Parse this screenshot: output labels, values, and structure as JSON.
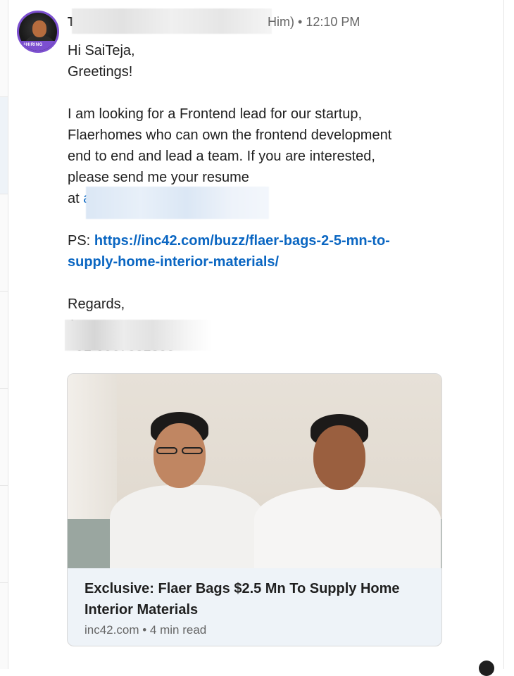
{
  "message": {
    "sender_initial": "T",
    "sender_tail": "Him)",
    "time": "12:10 PM",
    "avatar_badge": "#HIRING",
    "lines": [
      "Hi SaiTeja,",
      "Greetings!",
      "",
      "I am looking for a Frontend lead for our startup,",
      "Flaerhomes who can own the frontend development",
      "end to end and lead a team. If you are interested,",
      "please send me your resume"
    ],
    "email_prefix": "at",
    "email_fragment": "a",
    "ps_label": "PS:",
    "ps_link_line1": "https://inc42.com/buzz/flaer-bags-2-5-mn-to-",
    "ps_link_line2": "supply-home-interior-materials/",
    "regards": "Regards,",
    "signature_fragment": "A",
    "phone_fragment": "+91-9967831300"
  },
  "link_preview": {
    "title": "Exclusive: Flaer Bags $2.5 Mn To Supply Home Interior Materials",
    "source": "inc42.com",
    "separator": "•",
    "read_time": "4 min read"
  },
  "colors": {
    "link": "#0a66c2",
    "avatar_ring": "#7c4fd0",
    "card_bg": "#eef3f8"
  }
}
